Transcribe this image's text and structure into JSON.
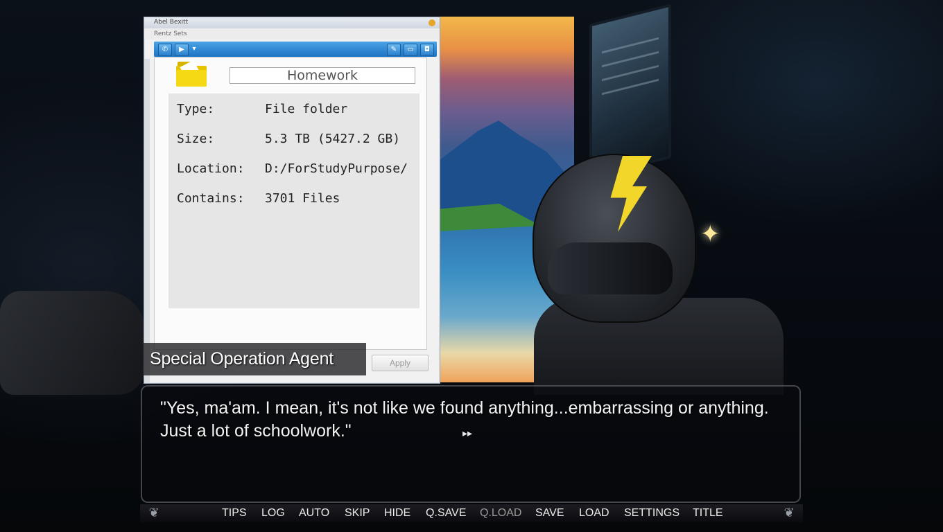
{
  "window": {
    "title": "Abel Bexitt",
    "subtitle": "Rentz Sets",
    "toolbar_icons": [
      "phone-icon",
      "play-icon",
      "dropdown-icon",
      "pencil-icon",
      "comment-icon",
      "info-icon"
    ],
    "folder_name": "Homework",
    "properties": [
      {
        "key": "Type:",
        "value": "File folder"
      },
      {
        "key": "Size:",
        "value": "5.3 TB (5427.2 GB)"
      },
      {
        "key": "Location:",
        "value": "D:/ForStudyPurpose/"
      },
      {
        "key": "Contains:",
        "value": "3701 Files"
      }
    ],
    "apply_label": "Apply"
  },
  "speaker": "Special Operation Agent",
  "dialogue": "\"Yes, ma'am. I mean, it's not like we found anything...embarrassing or anything. Just a lot of schoolwork.\"",
  "continue_indicator": "▸▸",
  "quick_menu": {
    "items": [
      {
        "label": "TIPS",
        "enabled": true
      },
      {
        "label": "LOG",
        "enabled": true
      },
      {
        "label": "AUTO",
        "enabled": true
      },
      {
        "label": "SKIP",
        "enabled": true
      },
      {
        "label": "HIDE",
        "enabled": true
      },
      {
        "label": "Q.SAVE",
        "enabled": true
      },
      {
        "label": "Q.LOAD",
        "enabled": false
      },
      {
        "label": "SAVE",
        "enabled": true
      },
      {
        "label": "LOAD",
        "enabled": true
      },
      {
        "label": "SETTINGS",
        "enabled": true
      },
      {
        "label": "TITLE",
        "enabled": true
      }
    ]
  },
  "colors": {
    "toolbar_blue": "#1e73c2",
    "folder_yellow": "#f5d915",
    "bolt_yellow": "#f3d62a"
  }
}
